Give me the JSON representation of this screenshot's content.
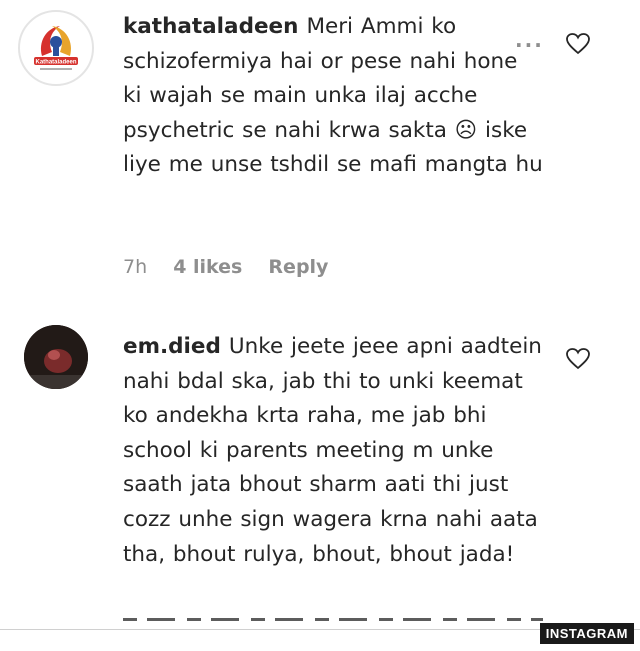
{
  "comments": [
    {
      "username": "kathataladeen",
      "text": "Meri Ammi ko schizofermiya hai or pese nahi hone ki wajah se main unka ilaj acche psychetric se nahi krwa sakta ☹ iske liye me unse tshdil se mafi mangta hu",
      "time": "7h",
      "likes": "4 likes",
      "reply": "Reply",
      "more_label": "···",
      "avatar_logo_text": "Kathataladeen"
    },
    {
      "username": "em.died",
      "text": "Unke jeete jeee apni aadtein nahi bdal ska, jab thi to unki keemat ko andekha krta raha, me jab bhi school ki parents meeting m unke saath jata bhout sharm aati thi just cozz unhe sign wagera krna nahi aata tha, bhout rulya, bhout, bhout jada!"
    }
  ],
  "watermark": "INSTAGRAM",
  "colors": {
    "text": "#262626",
    "muted": "#8e8e8e",
    "logo_red": "#d6322e",
    "logo_blue": "#2a4f9c"
  },
  "icons": [
    "more-options-icon",
    "heart-icon"
  ]
}
